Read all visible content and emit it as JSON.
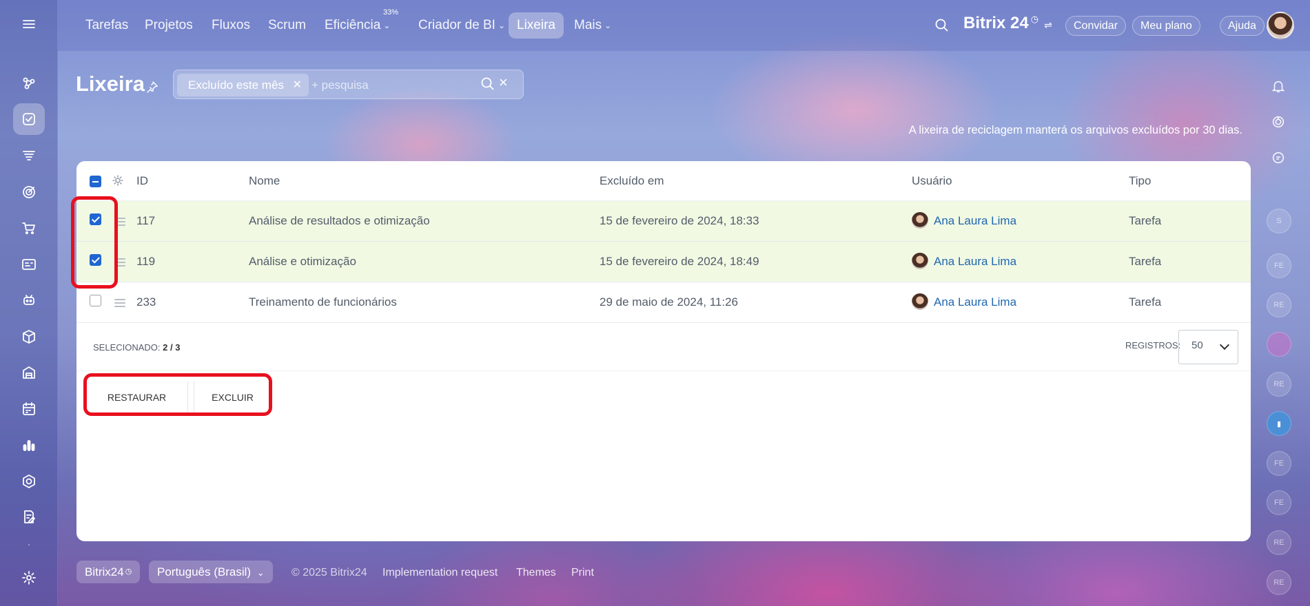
{
  "topnav": {
    "items": [
      {
        "label": "Tarefas"
      },
      {
        "label": "Projetos"
      },
      {
        "label": "Fluxos"
      },
      {
        "label": "Scrum"
      },
      {
        "label": "Eficiência",
        "badge": "33%"
      },
      {
        "label": "Criador de BI"
      },
      {
        "label": "Lixeira",
        "active": true
      },
      {
        "label": "Mais"
      }
    ],
    "brand": "Bitrix 24",
    "invite": "Convidar",
    "plan": "Meu plano",
    "help": "Ajuda"
  },
  "sidebar_icons": [
    "flows-icon",
    "tasks-icon",
    "funnel-icon",
    "target-icon",
    "cart-icon",
    "cards-icon",
    "robot-icon",
    "box-icon",
    "store-icon",
    "calendar-icon",
    "analytics-icon",
    "hexagon-icon",
    "sign-icon",
    "settings-icon"
  ],
  "page": {
    "title": "Lixeira",
    "filter_chip": "Excluído este mês",
    "search_placeholder": "+ pesquisa",
    "notice": "A lixeira de reciclagem manterá os arquivos excluídos por 30 dias."
  },
  "table": {
    "headers": {
      "id": "ID",
      "name": "Nome",
      "deleted": "Excluído em",
      "user": "Usuário",
      "type": "Tipo"
    },
    "rows": [
      {
        "id": "117",
        "name": "Análise de resultados e otimização",
        "deleted": "15 de fevereiro de 2024, 18:33",
        "user": "Ana Laura Lima",
        "type": "Tarefa",
        "checked": true
      },
      {
        "id": "119",
        "name": "Análise e otimização",
        "deleted": "15 de fevereiro de 2024, 18:49",
        "user": "Ana Laura Lima",
        "type": "Tarefa",
        "checked": true
      },
      {
        "id": "233",
        "name": "Treinamento de funcionários",
        "deleted": "29 de maio de 2024, 11:26",
        "user": "Ana Laura Lima",
        "type": "Tarefa",
        "checked": false
      }
    ],
    "selected_label": "SELECIONADO:",
    "selected_count": "2 / 3",
    "records_label": "REGISTROS:",
    "records_value": "50"
  },
  "actions": {
    "restore": "RESTAURAR",
    "delete": "EXCLUIR"
  },
  "right_rail": {
    "avatars": [
      "S",
      "FE",
      "RE",
      "",
      "RE",
      "",
      "FE",
      "FE",
      "RE",
      "RE"
    ]
  },
  "footer": {
    "brand": "Bitrix24",
    "language": "Português (Brasil)",
    "copyright": "© 2025 Bitrix24",
    "impl": "Implementation request",
    "themes": "Themes",
    "print": "Print"
  },
  "colors": {
    "accent": "#2066d2",
    "link": "#2067b0",
    "selected_row": "#f1f9e3",
    "annotation": "#e8101e"
  }
}
